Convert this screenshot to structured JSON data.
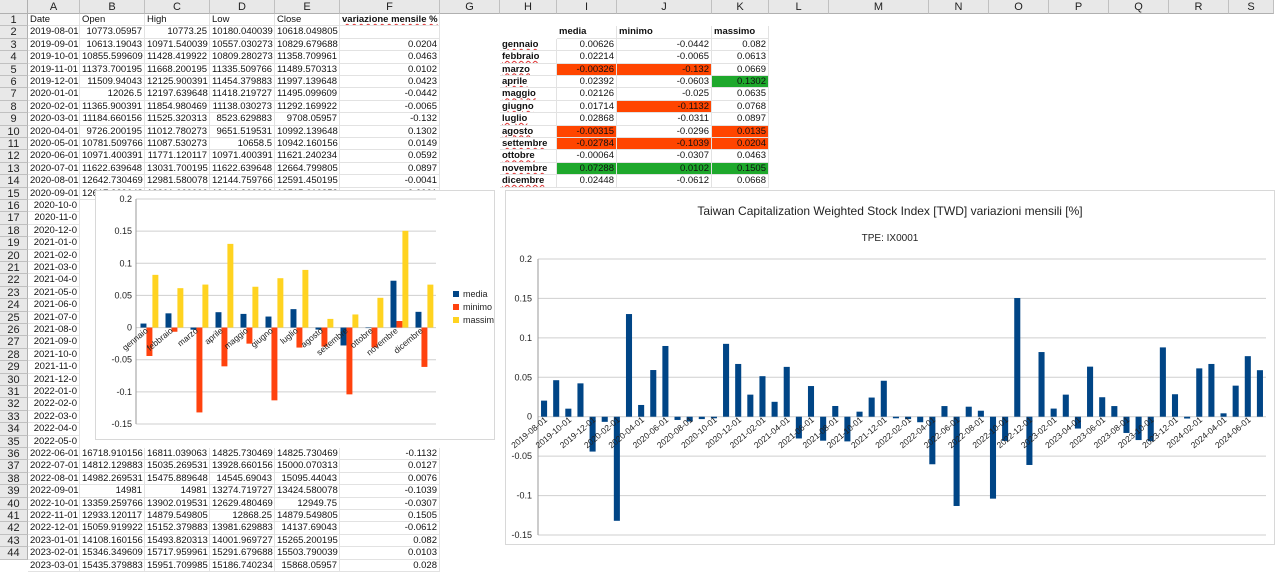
{
  "columns": [
    "A",
    "B",
    "C",
    "D",
    "E",
    "F",
    "G",
    "H",
    "I",
    "J",
    "K",
    "L",
    "M",
    "N",
    "O",
    "P",
    "Q",
    "R",
    "S"
  ],
  "rows": [
    1,
    2,
    3,
    4,
    5,
    6,
    7,
    8,
    9,
    10,
    11,
    12,
    13,
    14,
    15,
    16,
    17,
    18,
    19,
    20,
    21,
    22,
    23,
    24,
    25,
    26,
    27,
    28,
    29,
    30,
    31,
    32,
    33,
    34,
    35,
    36,
    37,
    38,
    39,
    40,
    41,
    42,
    43,
    44
  ],
  "headers": {
    "date": "Date",
    "open": "Open",
    "high": "High",
    "low": "Low",
    "close": "Close",
    "var": "variazione mensile %"
  },
  "top_rows": [
    [
      "2019-08-01",
      "10773.05957",
      "10773.25",
      "10180.040039",
      "10618.049805",
      ""
    ],
    [
      "2019-09-01",
      "10613.19043",
      "10971.540039",
      "10557.030273",
      "10829.679688",
      "0.0204"
    ],
    [
      "2019-10-01",
      "10855.599609",
      "11428.419922",
      "10809.280273",
      "11358.709961",
      "0.0463"
    ],
    [
      "2019-11-01",
      "11373.700195",
      "11668.200195",
      "11335.509766",
      "11489.570313",
      "0.0102"
    ],
    [
      "2019-12-01",
      "11509.94043",
      "12125.900391",
      "11454.379883",
      "11997.139648",
      "0.0423"
    ],
    [
      "2020-01-01",
      "12026.5",
      "12197.639648",
      "11418.219727",
      "11495.099609",
      "-0.0442"
    ],
    [
      "2020-02-01",
      "11365.900391",
      "11854.980469",
      "11138.030273",
      "11292.169922",
      "-0.0065"
    ],
    [
      "2020-03-01",
      "11184.660156",
      "11525.320313",
      "8523.629883",
      "9708.05957",
      "-0.132"
    ],
    [
      "2020-04-01",
      "9726.200195",
      "11012.780273",
      "9651.519531",
      "10992.139648",
      "0.1302"
    ],
    [
      "2020-05-01",
      "10781.509766",
      "11087.530273",
      "10658.5",
      "10942.160156",
      "0.0149"
    ],
    [
      "2020-06-01",
      "10971.400391",
      "11771.120117",
      "10971.400391",
      "11621.240234",
      "0.0592"
    ],
    [
      "2020-07-01",
      "11622.639648",
      "13031.700195",
      "11622.639648",
      "12664.799805",
      "0.0897"
    ],
    [
      "2020-08-01",
      "12642.730469",
      "12981.580078",
      "12144.759766",
      "12591.450195",
      "-0.0041"
    ],
    [
      "2020-09-01",
      "12617.229648",
      "12201.660000",
      "12140.900000",
      "12515.610352",
      "-0.0061"
    ]
  ],
  "left_dates": [
    "2020-10-0",
    "2020-11-0",
    "2020-12-0",
    "2021-01-0",
    "2021-02-0",
    "2021-03-0",
    "2021-04-0",
    "2021-05-0",
    "2021-06-0",
    "2021-07-0",
    "2021-08-0",
    "2021-09-0",
    "2021-10-0",
    "2021-11-0",
    "2021-12-0",
    "2022-01-0",
    "2022-02-0",
    "2022-03-0",
    "2022-04-0",
    "2022-05-0"
  ],
  "bottom_rows": [
    [
      "2022-06-01",
      "16718.910156",
      "16811.039063",
      "14825.730469",
      "14825.730469",
      "-0.1132"
    ],
    [
      "2022-07-01",
      "14812.129883",
      "15035.269531",
      "13928.660156",
      "15000.070313",
      "0.0127"
    ],
    [
      "2022-08-01",
      "14982.269531",
      "15475.889648",
      "14545.69043",
      "15095.44043",
      "0.0076"
    ],
    [
      "2022-09-01",
      "14981",
      "14981",
      "13274.719727",
      "13424.580078",
      "-0.1039"
    ],
    [
      "2022-10-01",
      "13359.259766",
      "13902.019531",
      "12629.480469",
      "12949.75",
      "-0.0307"
    ],
    [
      "2022-11-01",
      "12933.120117",
      "14879.549805",
      "12868.25",
      "14879.549805",
      "0.1505"
    ],
    [
      "2022-12-01",
      "15059.919922",
      "15152.379883",
      "13981.629883",
      "14137.69043",
      "-0.0612"
    ],
    [
      "2023-01-01",
      "14108.160156",
      "15493.820313",
      "14001.969727",
      "15265.200195",
      "0.082"
    ],
    [
      "2023-02-01",
      "15346.349609",
      "15717.959961",
      "15291.679688",
      "15503.790039",
      "0.0103"
    ],
    [
      "2023-03-01",
      "15435.379883",
      "15951.709985",
      "15186.740234",
      "15868.05957",
      "0.028"
    ]
  ],
  "stats": {
    "header": {
      "media": "media",
      "minimo": "minimo",
      "massimo": "massimo"
    },
    "months": [
      {
        "name": "gennaio",
        "media": "0.00626",
        "minimo": "-0.0442",
        "massimo": "0.082"
      },
      {
        "name": "febbraio",
        "media": "0.02214",
        "minimo": "-0.0065",
        "massimo": "0.0613"
      },
      {
        "name": "marzo",
        "media": "-0.00326",
        "minimo": "-0.132",
        "massimo": "0.0669"
      },
      {
        "name": "aprile",
        "media": "0.02392",
        "minimo": "-0.0603",
        "massimo": "0.1302"
      },
      {
        "name": "maggio",
        "media": "0.02126",
        "minimo": "-0.025",
        "massimo": "0.0635"
      },
      {
        "name": "giugno",
        "media": "0.01714",
        "minimo": "-0.1132",
        "massimo": "0.0768"
      },
      {
        "name": "luglio",
        "media": "0.02868",
        "minimo": "-0.0311",
        "massimo": "0.0897"
      },
      {
        "name": "agosto",
        "media": "-0.00315",
        "minimo": "-0.0296",
        "massimo": "0.0135"
      },
      {
        "name": "settembre",
        "media": "-0.02784",
        "minimo": "-0.1039",
        "massimo": "0.0204"
      },
      {
        "name": "ottobre",
        "media": "-0.00064",
        "minimo": "-0.0307",
        "massimo": "0.0463"
      },
      {
        "name": "novembre",
        "media": "0.07288",
        "minimo": "0.0102",
        "massimo": "0.1505"
      },
      {
        "name": "dicembre",
        "media": "0.02448",
        "minimo": "-0.0612",
        "massimo": "0.0668"
      }
    ]
  },
  "colors": {
    "red": "#ff4500",
    "green": "#1ea82c",
    "blue": "#004586",
    "orange": "#ff420e",
    "yellow": "#ffd320"
  },
  "chart_data": [
    {
      "type": "bar",
      "categories": [
        "gennaio",
        "febbraio",
        "marzo",
        "aprile",
        "maggio",
        "giugno",
        "luglio",
        "agosto",
        "settembre",
        "ottobre",
        "novembre",
        "dicembre"
      ],
      "series": [
        {
          "name": "media",
          "color": "#004586",
          "values": [
            0.00626,
            0.02214,
            -0.00326,
            0.02392,
            0.02126,
            0.01714,
            0.02868,
            -0.00315,
            -0.02784,
            -0.00064,
            0.07288,
            0.02448
          ]
        },
        {
          "name": "minimo",
          "color": "#ff420e",
          "values": [
            -0.0442,
            -0.0065,
            -0.132,
            -0.0603,
            -0.025,
            -0.1132,
            -0.0311,
            -0.0296,
            -0.1039,
            -0.0307,
            0.0102,
            -0.0612
          ]
        },
        {
          "name": "massimo",
          "color": "#ffd320",
          "values": [
            0.082,
            0.0613,
            0.0669,
            0.1302,
            0.0635,
            0.0768,
            0.0897,
            0.0135,
            0.0204,
            0.0463,
            0.1505,
            0.0668
          ]
        }
      ],
      "ylim": [
        -0.15,
        0.2
      ],
      "yticks": [
        "0.2",
        "0.15",
        "0.1",
        "0.05",
        "0",
        "-0.05",
        "-0.1",
        "-0.15"
      ],
      "legend": "right"
    },
    {
      "type": "bar",
      "title": "Taiwan Capitalization Weighted Stock Index [TWD] variazioni mensili [%]",
      "subtitle": "TPE: IX0001",
      "ylim": [
        -0.15,
        0.2
      ],
      "yticks": [
        "0.2",
        "0.15",
        "0.1",
        "0.05",
        "0",
        "-0.05",
        "-0.1",
        "-0.15"
      ],
      "xtick_labels": [
        "2019-08-01",
        "2019-10-01",
        "2019-12-01",
        "2020-02-01",
        "2020-04-01",
        "2020-06-01",
        "2020-08-01",
        "2020-10-01",
        "2020-12-01",
        "2021-02-01",
        "2021-04-01",
        "2021-06-01",
        "2021-08-01",
        "2021-10-01",
        "2021-12-01",
        "2022-02-01",
        "2022-04-01",
        "2022-06-01",
        "2022-08-01",
        "2022-10-01",
        "2022-12-01",
        "2023-02-01",
        "2023-04-01",
        "2023-06-01",
        "2023-08-01",
        "2023-10-01",
        "2023-12-01",
        "2024-02-01",
        "2024-04-01",
        "2024-06-01"
      ],
      "values": [
        0.0204,
        0.0463,
        0.0102,
        0.0423,
        -0.0442,
        -0.0065,
        -0.132,
        0.1302,
        0.0149,
        0.0592,
        0.0897,
        -0.0041,
        -0.0061,
        -0.003,
        -0.002,
        0.0924,
        0.0669,
        0.028,
        0.0514,
        0.0189,
        0.0632,
        -0.0276,
        0.0389,
        -0.0304,
        0.0136,
        -0.0313,
        0.0064,
        0.0243,
        0.0456,
        -0.002,
        -0.003,
        -0.007,
        -0.0603,
        0.0135,
        -0.1132,
        0.0127,
        0.0076,
        -0.1039,
        -0.0307,
        0.1505,
        -0.0612,
        0.082,
        0.0103,
        0.028,
        -0.015,
        0.0635,
        0.0247,
        0.0135,
        -0.0206,
        -0.0296,
        -0.0311,
        0.0879,
        0.0285,
        -0.0023,
        0.0613,
        0.0669,
        0.0043,
        0.0394,
        0.0768,
        0.059
      ],
      "color": "#004586"
    }
  ]
}
